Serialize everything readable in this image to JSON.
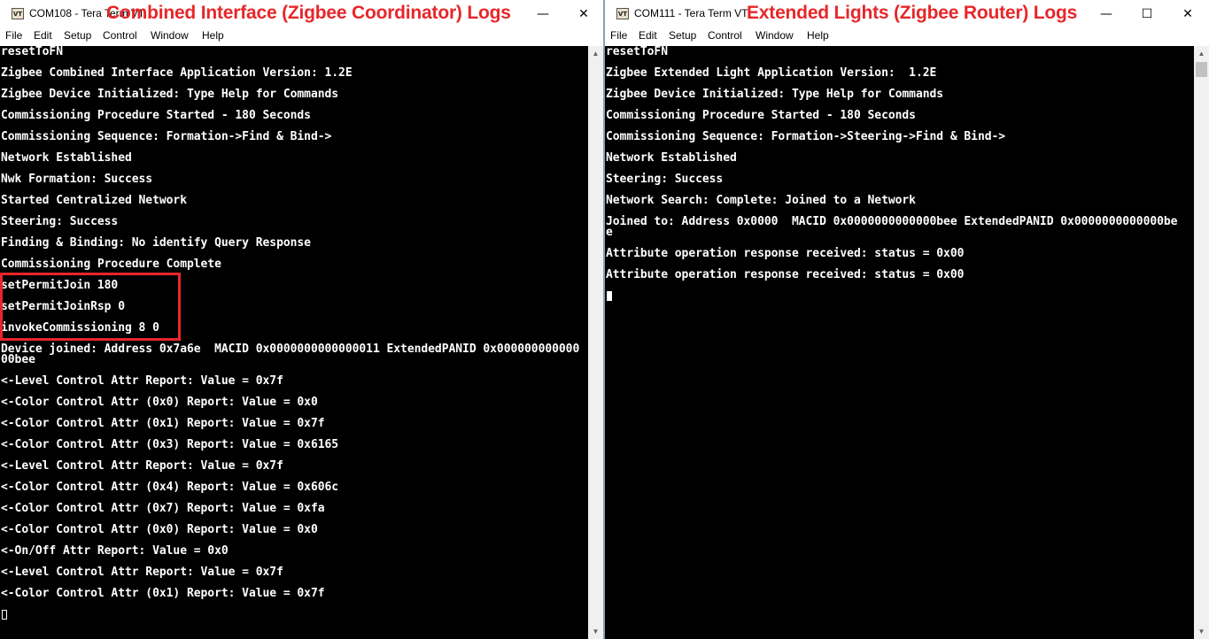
{
  "left": {
    "title": "COM108 - Tera Term VT",
    "overlay": "Combined Interface (Zigbee Coordinator) Logs",
    "menu": [
      "File",
      "Edit",
      "Setup",
      "Control",
      "Window",
      "Help"
    ],
    "lines": [
      "resetToFN",
      "Zigbee Combined Interface Application Version: 1.2E",
      "Zigbee Device Initialized: Type Help for Commands",
      "Commissioning Procedure Started - 180 Seconds",
      "Commissioning Sequence: Formation->Find & Bind->",
      "Network Established",
      "Nwk Formation: Success",
      "Started Centralized Network",
      "Steering: Success",
      "Finding & Binding: No identify Query Response",
      "Commissioning Procedure Complete",
      "setPermitJoin 180",
      "setPermitJoinRsp 0",
      "invokeCommissioning 8 0",
      "Device joined: Address 0x7a6e  MACID 0x0000000000000011 ExtendedPANID 0x000000000000",
      "00bee",
      "<-Level Control Attr Report: Value = 0x7f",
      "<-Color Control Attr (0x0) Report: Value = 0x0",
      "<-Color Control Attr (0x1) Report: Value = 0x7f",
      "<-Color Control Attr (0x3) Report: Value = 0x6165",
      "<-Level Control Attr Report: Value = 0x7f",
      "<-Color Control Attr (0x4) Report: Value = 0x606c",
      "<-Color Control Attr (0x7) Report: Value = 0xfa",
      "<-Color Control Attr (0x0) Report: Value = 0x0",
      "<-On/Off Attr Report: Value = 0x0",
      "<-Level Control Attr Report: Value = 0x7f",
      "<-Color Control Attr (0x1) Report: Value = 0x7f"
    ]
  },
  "right": {
    "title": "COM111 - Tera Term VT",
    "overlay": "Extended Lights (Zigbee Router) Logs",
    "menu": [
      "File",
      "Edit",
      "Setup",
      "Control",
      "Window",
      "Help"
    ],
    "lines": [
      "resetToFN",
      "Zigbee Extended Light Application Version:  1.2E",
      "Zigbee Device Initialized: Type Help for Commands",
      "Commissioning Procedure Started - 180 Seconds",
      "Commissioning Sequence: Formation->Steering->Find & Bind->",
      "Network Established",
      "Steering: Success",
      "Network Search: Complete: Joined to a Network",
      "Joined to: Address 0x0000  MACID 0x0000000000000bee ExtendedPANID 0x0000000000000be",
      "e",
      "Attribute operation response received: status = 0x00",
      "Attribute operation response received: status = 0x00"
    ]
  },
  "window_buttons": {
    "minimize": "—",
    "maximize": "☐",
    "close": "✕"
  },
  "colors": {
    "overlay": "#e8262a",
    "terminal_bg": "#000000",
    "terminal_fg": "#ffffff"
  }
}
